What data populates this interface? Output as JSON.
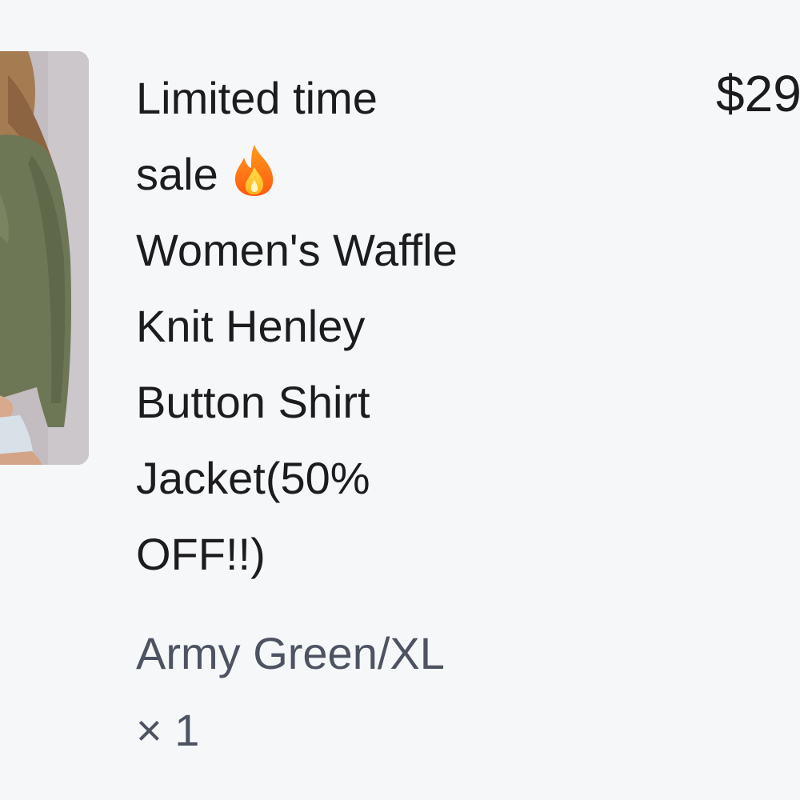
{
  "line_item": {
    "title_lines": [
      "Limited time",
      "sale",
      "Women's Waffle",
      "Knit Henley",
      "Button Shirt",
      "Jacket(50%",
      "OFF!!)"
    ],
    "title_icon": "fire-icon",
    "price": "$29",
    "variant": "Army Green/XL",
    "quantity": "× 1",
    "image_alt": "Army green waffle knit henley shirt"
  }
}
